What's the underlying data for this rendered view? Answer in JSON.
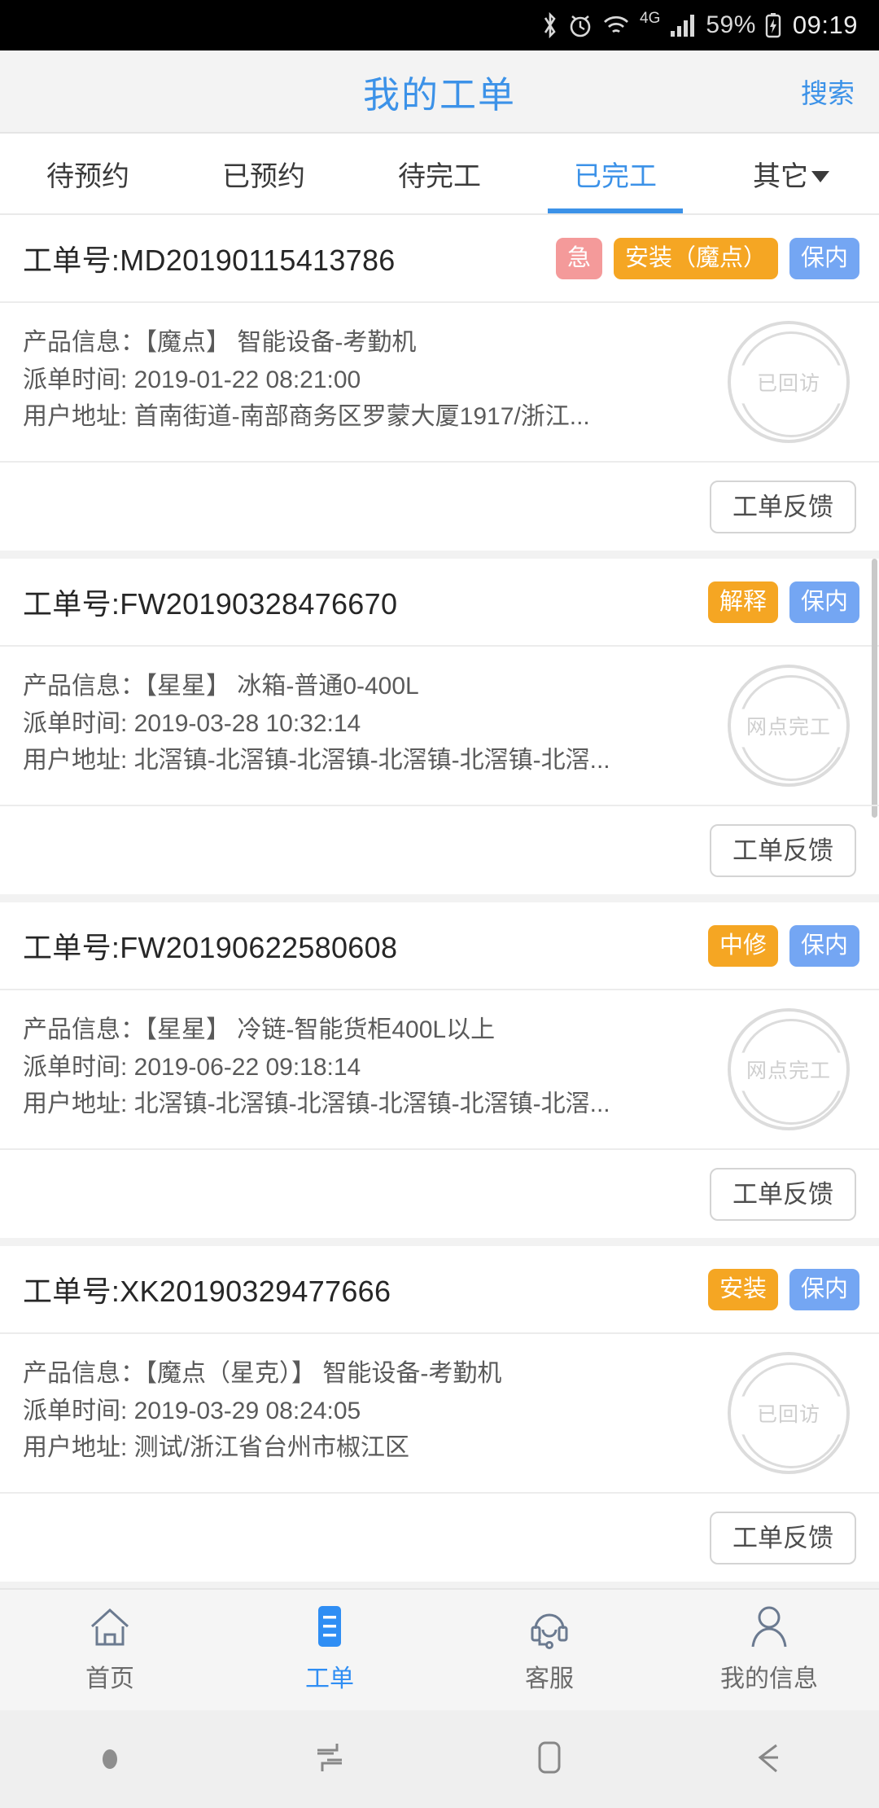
{
  "statusbar": {
    "icons": [
      "bluetooth-icon",
      "alarm-icon",
      "wifi-icon",
      "signal-icon",
      "battery-icon"
    ],
    "network": "4G",
    "battery_percent": "59%",
    "time": "09:19"
  },
  "header": {
    "title": "我的工单",
    "search_label": "搜索"
  },
  "tabs": [
    {
      "label": "待预约",
      "active": false
    },
    {
      "label": "已预约",
      "active": false
    },
    {
      "label": "待完工",
      "active": false
    },
    {
      "label": "已完工",
      "active": true
    },
    {
      "label": "其它",
      "active": false,
      "has_caret": true
    }
  ],
  "labels": {
    "wo_prefix": "工单号:",
    "product_prefix": "产品信息：",
    "dispatch_prefix": "派单时间: ",
    "address_prefix": "用户地址: ",
    "feedback": "工单反馈"
  },
  "orders": [
    {
      "wo_no": "工单号:MD20190115413786",
      "badges": [
        {
          "text": "急",
          "style": "urgent"
        },
        {
          "text": "安装（魔点）",
          "style": "type"
        },
        {
          "text": "保内",
          "style": "warranty"
        }
      ],
      "product": "产品信息：【魔点】 智能设备-考勤机",
      "dispatch": "派单时间: 2019-01-22 08:21:00",
      "address": "用户地址: 首南街道-南部商务区罗蒙大厦1917/浙江...",
      "stamp": "已回访",
      "feedback": "工单反馈"
    },
    {
      "wo_no": "工单号:FW20190328476670",
      "badges": [
        {
          "text": "解释",
          "style": "type"
        },
        {
          "text": "保内",
          "style": "warranty"
        }
      ],
      "product": "产品信息：【星星】 冰箱-普通0-400L",
      "dispatch": "派单时间: 2019-03-28 10:32:14",
      "address": "用户地址: 北滘镇-北滘镇-北滘镇-北滘镇-北滘镇-北滘...",
      "stamp": "网点完工",
      "feedback": "工单反馈"
    },
    {
      "wo_no": "工单号:FW20190622580608",
      "badges": [
        {
          "text": "中修",
          "style": "type"
        },
        {
          "text": "保内",
          "style": "warranty"
        }
      ],
      "product": "产品信息：【星星】 冷链-智能货柜400L以上",
      "dispatch": "派单时间: 2019-06-22 09:18:14",
      "address": "用户地址: 北滘镇-北滘镇-北滘镇-北滘镇-北滘镇-北滘...",
      "stamp": "网点完工",
      "feedback": "工单反馈"
    },
    {
      "wo_no": "工单号:XK20190329477666",
      "badges": [
        {
          "text": "安装",
          "style": "type"
        },
        {
          "text": "保内",
          "style": "warranty"
        }
      ],
      "product": "产品信息：【魔点（星克）】 智能设备-考勤机",
      "dispatch": "派单时间: 2019-03-29 08:24:05",
      "address": "用户地址: 测试/浙江省台州市椒江区",
      "stamp": "已回访",
      "feedback": "工单反馈"
    }
  ],
  "bottomnav": [
    {
      "label": "首页",
      "icon": "home-icon",
      "active": false
    },
    {
      "label": "工单",
      "icon": "list-icon",
      "active": true
    },
    {
      "label": "客服",
      "icon": "headset-icon",
      "active": false
    },
    {
      "label": "我的信息",
      "icon": "person-icon",
      "active": false
    }
  ],
  "androidnav": [
    {
      "icon": "dot-icon"
    },
    {
      "icon": "recents-icon"
    },
    {
      "icon": "home-square-icon"
    },
    {
      "icon": "back-icon"
    }
  ],
  "colors": {
    "accent": "#3c92e8",
    "urgent": "#f49a9a",
    "type": "#f5a623",
    "warranty": "#74a6f3",
    "stamp": "#dcdcdc"
  }
}
